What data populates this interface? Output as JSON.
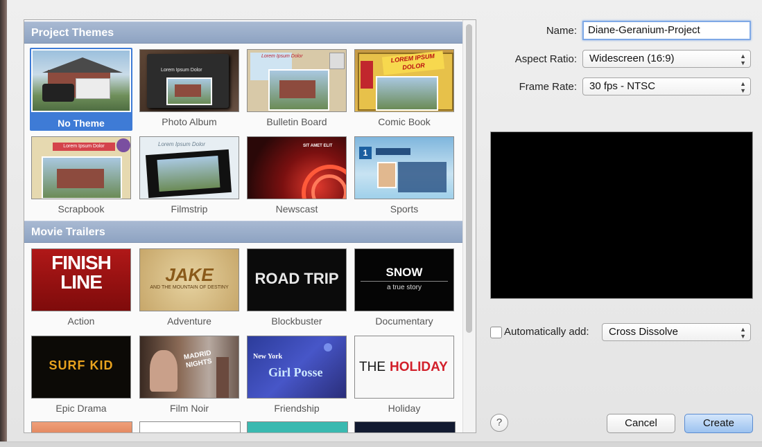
{
  "sections": {
    "project_themes": "Project Themes",
    "movie_trailers": "Movie Trailers"
  },
  "themes": [
    {
      "label": "No Theme"
    },
    {
      "label": "Photo Album",
      "overlay": "Lorem Ipsum Dolor"
    },
    {
      "label": "Bulletin Board",
      "overlay": "Lorem Ipsum Dolor"
    },
    {
      "label": "Comic Book",
      "overlay": "LOREM IPSUM DOLOR"
    },
    {
      "label": "Scrapbook",
      "overlay": "Lorem Ipsum Dolor"
    },
    {
      "label": "Filmstrip",
      "overlay": "Lorem Ipsum Dolor"
    },
    {
      "label": "Newscast",
      "overlay": "SIT AMET ELIT"
    },
    {
      "label": "Sports",
      "overlay": "1"
    }
  ],
  "trailers": [
    {
      "label": "Action",
      "title": "FINISH LINE"
    },
    {
      "label": "Adventure",
      "title": "JAKE",
      "subtitle": "AND THE MOUNTAIN OF DESTINY"
    },
    {
      "label": "Blockbuster",
      "title": "ROAD TRIP"
    },
    {
      "label": "Documentary",
      "title": "SNOW",
      "subtitle": "a true story"
    },
    {
      "label": "Epic Drama",
      "title": "SURF KID"
    },
    {
      "label": "Film Noir",
      "title": "MADRID NIGHTS"
    },
    {
      "label": "Friendship",
      "title": "Girl Posse",
      "subtitle": "New York"
    },
    {
      "label": "Holiday",
      "title": "HOLIDAY",
      "subtitle": "THE"
    }
  ],
  "form": {
    "name_label": "Name:",
    "name_value": "Diane-Geranium-Project",
    "aspect_label": "Aspect Ratio:",
    "aspect_value": "Widescreen (16:9)",
    "frame_label": "Frame Rate:",
    "frame_value": "30 fps - NTSC",
    "auto_add_label": "Automatically add:",
    "auto_add_value": "Cross Dissolve",
    "auto_add_checked": false
  },
  "buttons": {
    "help": "?",
    "cancel": "Cancel",
    "create": "Create"
  },
  "colors": {
    "selection": "#3e7bd6",
    "header": "#8ea3c2"
  }
}
